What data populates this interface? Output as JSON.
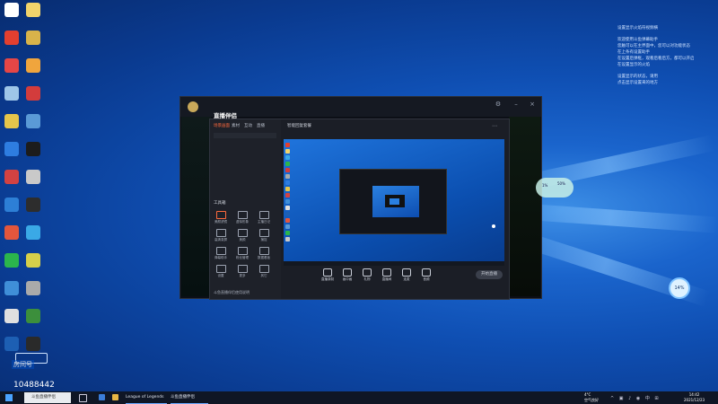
{
  "desktop": {
    "icons_left": [
      "app",
      "app",
      "app",
      "app",
      "app",
      "app",
      "app",
      "app",
      "app",
      "app",
      "app",
      "app",
      "app",
      "app",
      "app",
      "app",
      "app",
      "app",
      "app",
      "app",
      "app",
      "app"
    ],
    "icon_colors": [
      "#ffffff",
      "#f1d36b",
      "#e33f2f",
      "#d8b34a",
      "#e64646",
      "#f0a53d",
      "#9ec6e8",
      "#d33c3c",
      "#e6c64b",
      "#5a9ad6",
      "#2e7de0",
      "#1c1c1c",
      "#d24242",
      "#c9c9c9",
      "#2d7fd6",
      "#2d2d2d",
      "#e3563c",
      "#3aa9e6",
      "#2bb54c",
      "#d6cf4a",
      "#3f8ed8",
      "#aaaaaa",
      "#e0e0e0",
      "#3c8f3c",
      "#1d5fb3",
      "#2a2a2a"
    ],
    "notes": [
      "设置显示火焰符视频横",
      "",
      "欢迎使用斗鱼弹幕助手",
      "您触可以在主界面中，您可以对功能状态",
      "在上条有设置助手",
      "在设置后弹框，观看后看后方，都可以开启",
      "在设置显示的火焰",
      "",
      "设置显示的状态，请用",
      "点击显示设置来的地方"
    ],
    "disk_widget": {
      "top": "1%",
      "bottom": "50%"
    },
    "cpu_gauge": "14%",
    "streamer": {
      "label": "房间号",
      "id": "10488442"
    }
  },
  "app": {
    "title": "直播伴侣",
    "close_icon": "close-icon",
    "min_icon": "minimize-icon"
  },
  "tool": {
    "tabs": [
      "场景画面",
      "素材",
      "互动",
      "直播"
    ],
    "section_title": "工具箱",
    "cells": [
      "美颜滤镜",
      "虚拟形象",
      "主播日记",
      "高清录屏",
      "美颜",
      "捕捉",
      "弹幕助手",
      "粉丝管理",
      "数据看板",
      "设置",
      "更多",
      "其它"
    ],
    "footer": "斗鱼直播伴侣使用说明",
    "head_label": "智能回复套餐"
  },
  "controls": {
    "items": [
      "直播录制",
      "画中画",
      "礼物",
      "直播间",
      "连麦",
      "音频"
    ],
    "start": "开始直播"
  },
  "taskbar": {
    "search": "斗鱼直播伴侣",
    "items": [
      "League of Legends",
      "斗鱼直播伴侣"
    ],
    "weather": "4°C",
    "weather_sub": "空气良好",
    "time": "14:42",
    "date": "2021/12/23"
  }
}
